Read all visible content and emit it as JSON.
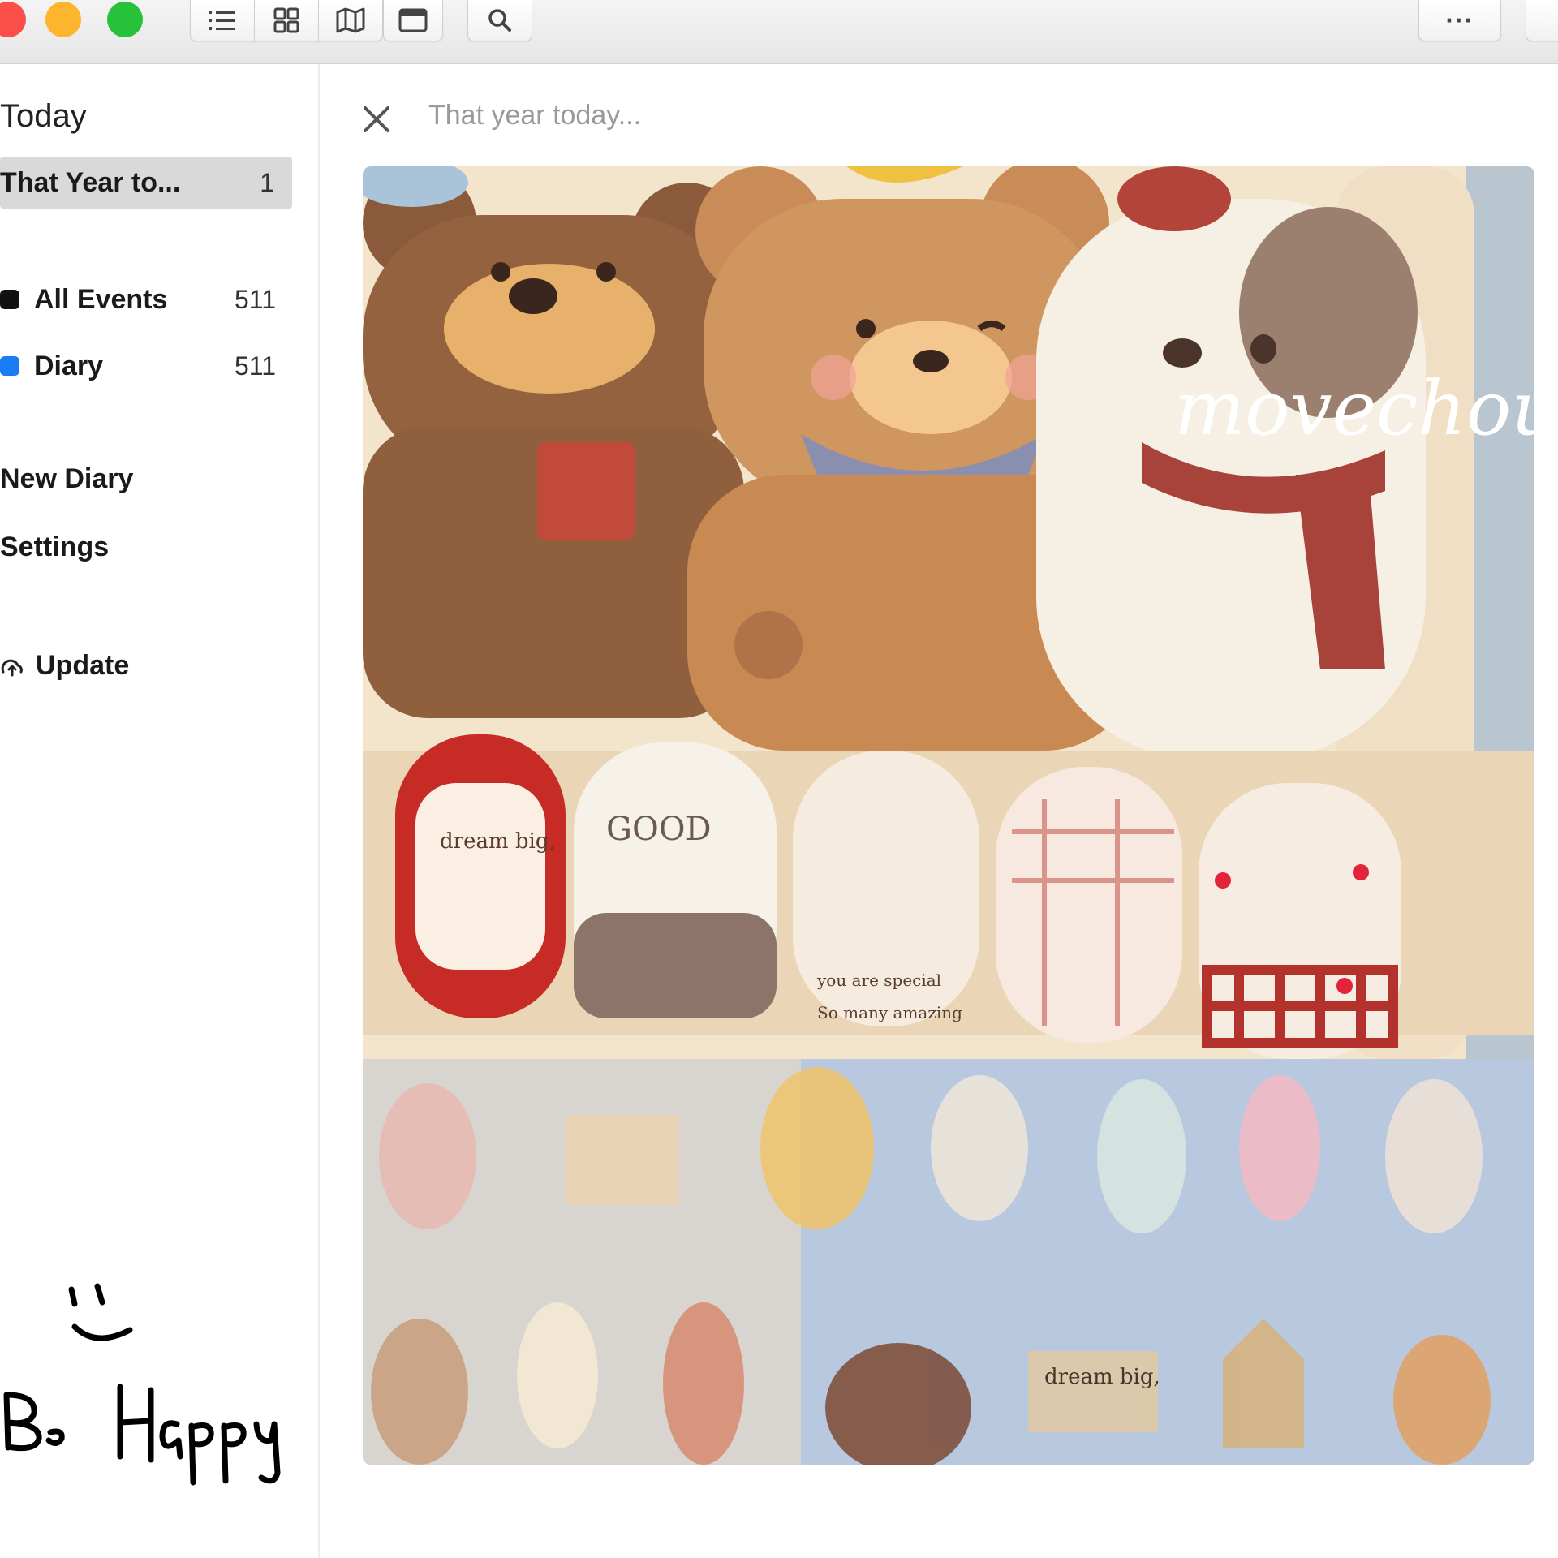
{
  "toolbar": {
    "buttons": [
      "list-view",
      "grid-view",
      "map-view",
      "calendar-view",
      "search"
    ],
    "more_label": "···"
  },
  "sidebar": {
    "heading": "Today",
    "selected_item": {
      "label": "That Year to...",
      "count": "1"
    },
    "calendars": [
      {
        "label": "All Events",
        "count": "511",
        "color": "#111111"
      },
      {
        "label": "Diary",
        "count": "511",
        "color": "#1a7cf5"
      }
    ],
    "new_diary_label": "New Diary",
    "settings_label": "Settings",
    "update_label": "Update",
    "handwriting_text": "Be Happy"
  },
  "main": {
    "placeholder": "That year today...",
    "photo": {
      "watermark": "movechou",
      "nail_texts": [
        "dream big,",
        "GOOD",
        "you are special",
        "So many amazing",
        "dream big,"
      ]
    }
  },
  "colors": {
    "close": "#fd4f4a",
    "minimize": "#fdb52e",
    "zoom": "#27c13c",
    "selection": "#d9d9d9"
  }
}
